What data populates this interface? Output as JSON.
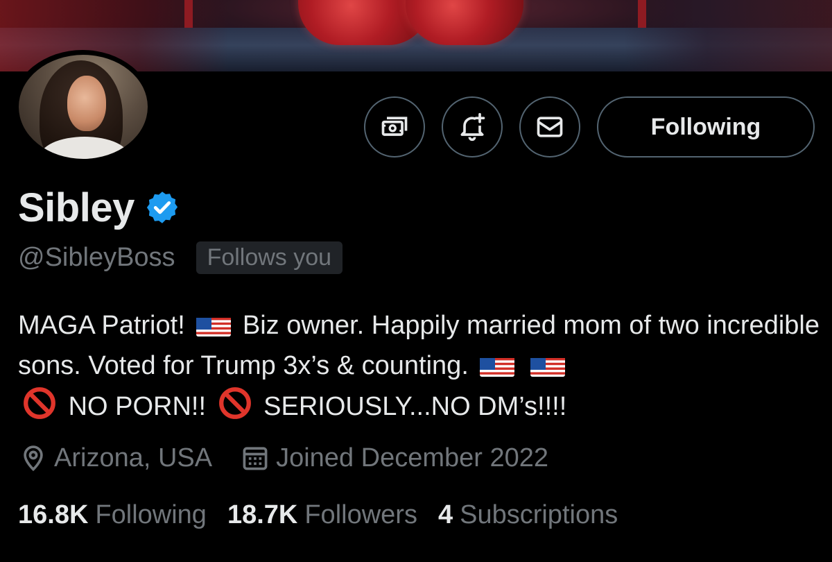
{
  "profile": {
    "name": "Sibley",
    "handle": "@SibleyBoss",
    "follows_you": "Follows you",
    "bio": {
      "part1": "MAGA Patriot!",
      "part2": "Biz owner. Happily married mom of two incredible sons. Voted for Trump 3x’s & counting.",
      "part3": "NO PORN!!",
      "part4": "SERIOUSLY...NO DM’s!!!!"
    },
    "location": "Arizona, USA",
    "joined": "Joined December 2022"
  },
  "actions": {
    "following_label": "Following",
    "icons": [
      "subscribe-icon",
      "notify-icon",
      "message-icon"
    ]
  },
  "stats": [
    {
      "value": "16.8K",
      "label": "Following"
    },
    {
      "value": "18.7K",
      "label": "Followers"
    },
    {
      "value": "4",
      "label": "Subscriptions"
    }
  ],
  "colors": {
    "verified": "#1d9bf0",
    "muted": "#71767b",
    "border": "#536471"
  }
}
